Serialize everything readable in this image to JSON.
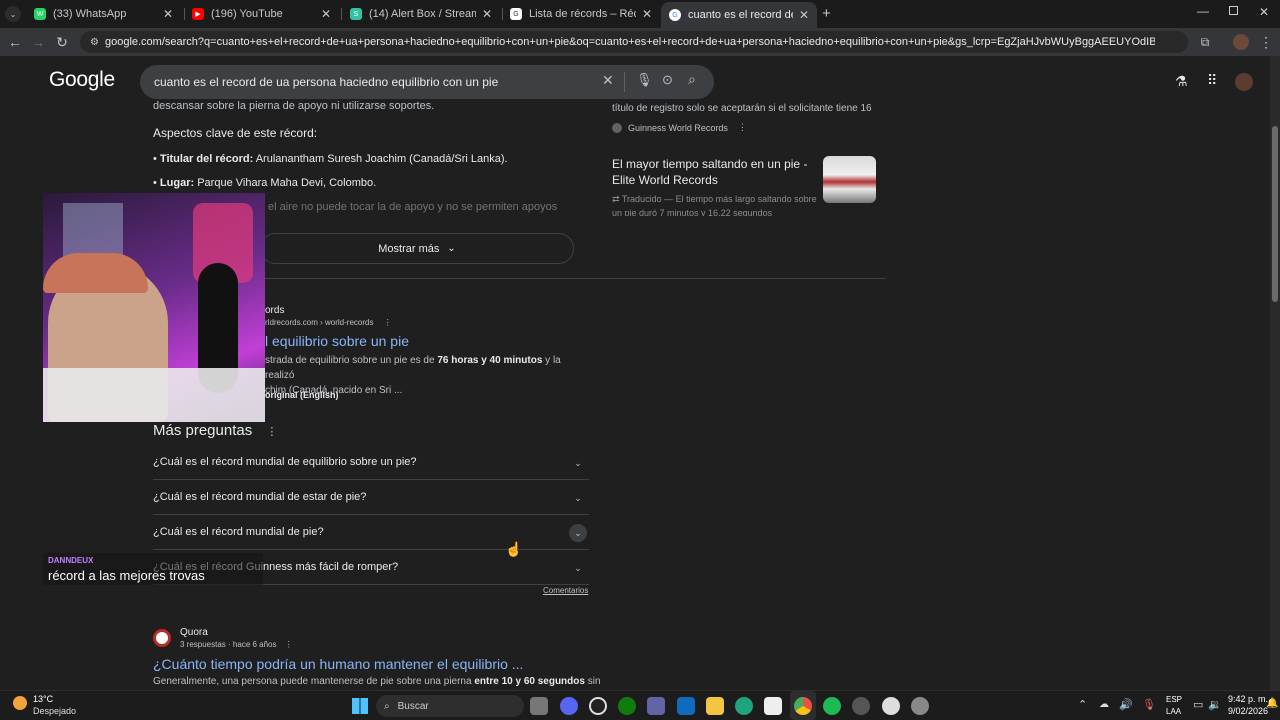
{
  "browser": {
    "tabs": [
      {
        "label": "(33) WhatsApp",
        "color": "#25d366",
        "glyph": "W"
      },
      {
        "label": "(196) YouTube",
        "color": "#ff0000",
        "glyph": "▶"
      },
      {
        "label": "(14) Alert Box / Streamlabs",
        "color": "#31c3a2",
        "glyph": "S"
      },
      {
        "label": "Lista de récords – Récord mund",
        "color": "#ffffff",
        "glyph": "G"
      },
      {
        "label": "cuanto es el record de ua perso",
        "color": "#4285f4",
        "glyph": "G"
      }
    ],
    "new_tab_glyph": "+",
    "url": "google.com/search?q=cuanto+es+el+record+de+ua+persona+haciedno+equilibrio+con+un+pie&oq=cuanto+es+el+record+de+ua+persona+haciedno+equilibrio+con+un+pie&gs_lcrp=EgZjaHJvbWUyBggAEEUYOdIBCTE2MDEwajBqN6gCALACAA&so..."
  },
  "google": {
    "logo": "Google",
    "query": "cuanto es el record de ua persona haciedno equilibrio con un pie"
  },
  "overview": {
    "cut_line": "descansar sobre la pierna de apoyo ni utilizarse soportes.",
    "aspects_heading": "Aspectos clave de este récord:",
    "bullet1_label": "Titular del récord:",
    "bullet1_text": "Arulanantham Suresh Joachim (Canadá/Sri Lanka).",
    "bullet2_label": "Lugar:",
    "bullet2_text": "Parque Vihara Maha Devi, Colombo.",
    "faded_line": "el aire no puede tocar la de apoyo y no se permiten apoyos",
    "show_more": "Mostrar más"
  },
  "right_sources": {
    "item1_text": "título de registro solo se aceptarán si el solicitante tiene 16...",
    "item1_source": "Guinness World Records",
    "item2_title": "El mayor tiempo saltando en un pie - Elite World Records",
    "item2_snippet": "Traducido — El tiempo más largo saltando sobre un pie duró 7 minutos y 16,22 segundos"
  },
  "result1": {
    "site": "ords",
    "breadcrumb": "rldrecords.com › world-records",
    "title": "l equilibrio sobre un pie",
    "snippet_a": "strada de equilibrio sobre un pie es de ",
    "snippet_bold": "76 horas y 40 minutos",
    "snippet_b": " y la realizó",
    "snippet_line2": "chim (Canadá, nacido en Sri ...",
    "original_label": "original (English)"
  },
  "more_questions": {
    "heading": "Más preguntas",
    "questions": [
      "¿Cuál es el récord mundial de equilibrio sobre un pie?",
      "¿Cuál es el récord mundial de estar de pie?",
      "¿Cuál es el récord mundial de pie?",
      "¿Cuál es el récord Guinness más fácil de romper?"
    ],
    "feedback": "Comentarios"
  },
  "result2": {
    "site": "Quora",
    "meta": "3 respuestas · hace 6 años",
    "title": "¿Cuánto tiempo podría un humano mantener el equilibrio ...",
    "snippet_a": "Generalmente, una persona puede mantenerse de pie sobre una pierna ",
    "snippet_bold": "entre 10 y 60 segundos",
    "snippet_b": " sin"
  },
  "overlay": {
    "channel": "DANNDEUX",
    "caption": "récord a las mejores trovas"
  },
  "taskbar": {
    "weather_temp": "13°C",
    "weather_desc": "Despejado",
    "search_label": "Buscar",
    "lang_top": "ESP",
    "lang_bottom": "LAA",
    "time": "9:42 p. m.",
    "date": "9/02/2026"
  }
}
